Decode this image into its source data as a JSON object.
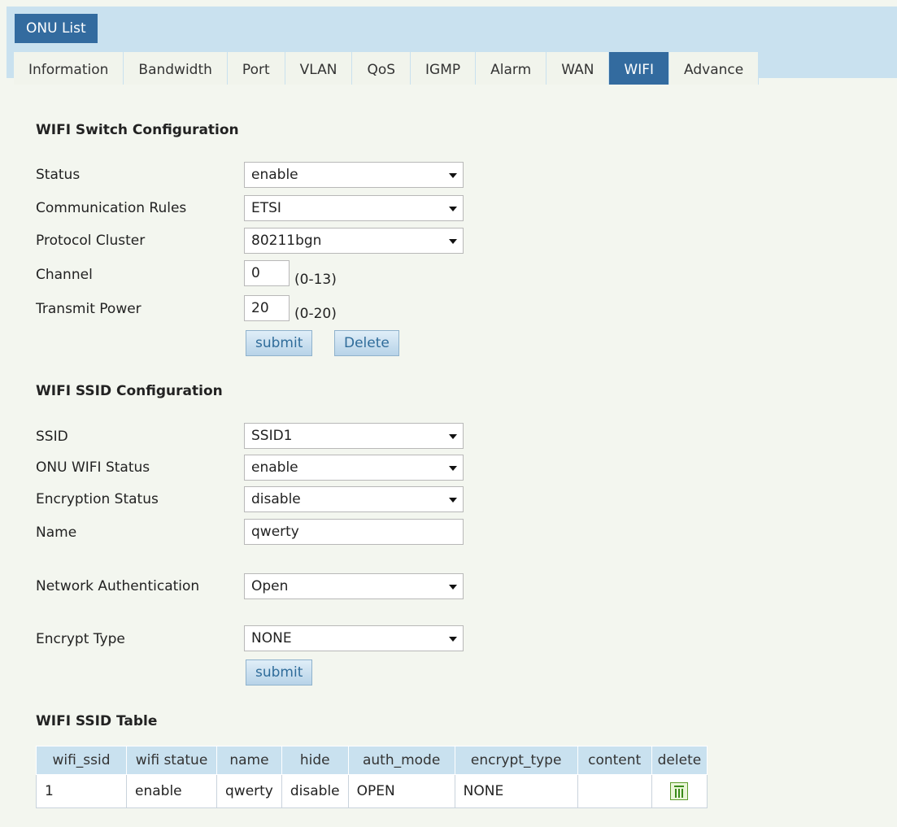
{
  "top": {
    "onu_list_label": "ONU List"
  },
  "tabs": [
    {
      "label": "Information"
    },
    {
      "label": "Bandwidth"
    },
    {
      "label": "Port"
    },
    {
      "label": "VLAN"
    },
    {
      "label": "QoS"
    },
    {
      "label": "IGMP"
    },
    {
      "label": "Alarm"
    },
    {
      "label": "WAN"
    },
    {
      "label": "WIFI"
    },
    {
      "label": "Advance"
    }
  ],
  "active_tab": "WIFI",
  "switch_config": {
    "title": "WIFI Switch Configuration",
    "status": {
      "label": "Status",
      "value": "enable"
    },
    "rules": {
      "label": "Communication Rules",
      "value": "ETSI"
    },
    "protocol": {
      "label": "Protocol Cluster",
      "value": "80211bgn"
    },
    "channel": {
      "label": "Channel",
      "value": "0",
      "hint": "(0-13)"
    },
    "power": {
      "label": "Transmit Power",
      "value": "20",
      "hint": "(0-20)"
    },
    "submit_label": "submit",
    "delete_label": "Delete"
  },
  "ssid_config": {
    "title": "WIFI SSID Configuration",
    "ssid": {
      "label": "SSID",
      "value": "SSID1"
    },
    "wifi_status": {
      "label": "ONU WIFI Status",
      "value": "enable"
    },
    "encryption_status": {
      "label": "Encryption Status",
      "value": "disable"
    },
    "name": {
      "label": "Name",
      "value": "qwerty"
    },
    "auth": {
      "label": "Network Authentication",
      "value": "Open"
    },
    "encrypt_type": {
      "label": "Encrypt Type",
      "value": "NONE"
    },
    "submit_label": "submit"
  },
  "ssid_table": {
    "title": "WIFI SSID Table",
    "headers": [
      "wifi_ssid",
      "wifi statue",
      "name",
      "hide",
      "auth_mode",
      "encrypt_type",
      "content",
      "delete"
    ],
    "rows": [
      [
        "1",
        "enable",
        "qwerty",
        "disable",
        "OPEN",
        "NONE",
        "",
        ""
      ]
    ],
    "delete_icon": "trash-icon"
  }
}
